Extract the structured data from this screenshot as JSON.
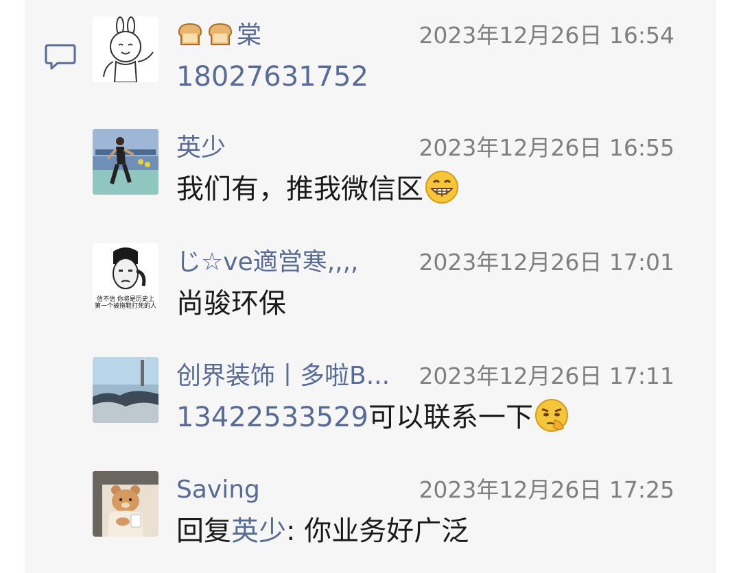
{
  "comments": [
    {
      "name": "棠",
      "name_prefix_icons": [
        "bread-emoji",
        "bread-emoji"
      ],
      "time": "2023年12月26日 16:54",
      "phone": "18027631752",
      "avatar": "rabbit-sketch-avatar"
    },
    {
      "name": "英少",
      "time": "2023年12月26日 16:55",
      "text": "我们有，推我微信区",
      "emoji": "grin-emoji",
      "avatar": "runner-photo-avatar"
    },
    {
      "name": "じ☆ve適営寒,,,,",
      "time": "2023年12月26日 17:01",
      "text": "尚骏环保",
      "avatar": "meme-face-avatar",
      "avatar_caption_line1": "信不信 你将是历史上",
      "avatar_caption_line2": "第一个被拖鞋打死的人"
    },
    {
      "name": "创界装饰丨多啦B...",
      "time": "2023年12月26日 17:11",
      "phone": "13422533529",
      "text": "可以联系一下",
      "emoji": "smirk-emoji",
      "avatar": "seashore-photo-avatar"
    },
    {
      "name": "Saving",
      "time": "2023年12月26日 17:25",
      "reply_prefix": "回复",
      "reply_to": "英少",
      "text": ": 你业务好广泛",
      "avatar": "bear-driver-avatar"
    }
  ],
  "colors": {
    "link": "#576b95",
    "time": "#7f7f7f",
    "text": "#1a1a1a",
    "panel": "#f6f6f6"
  },
  "icons": {
    "section": "comment-icon"
  }
}
